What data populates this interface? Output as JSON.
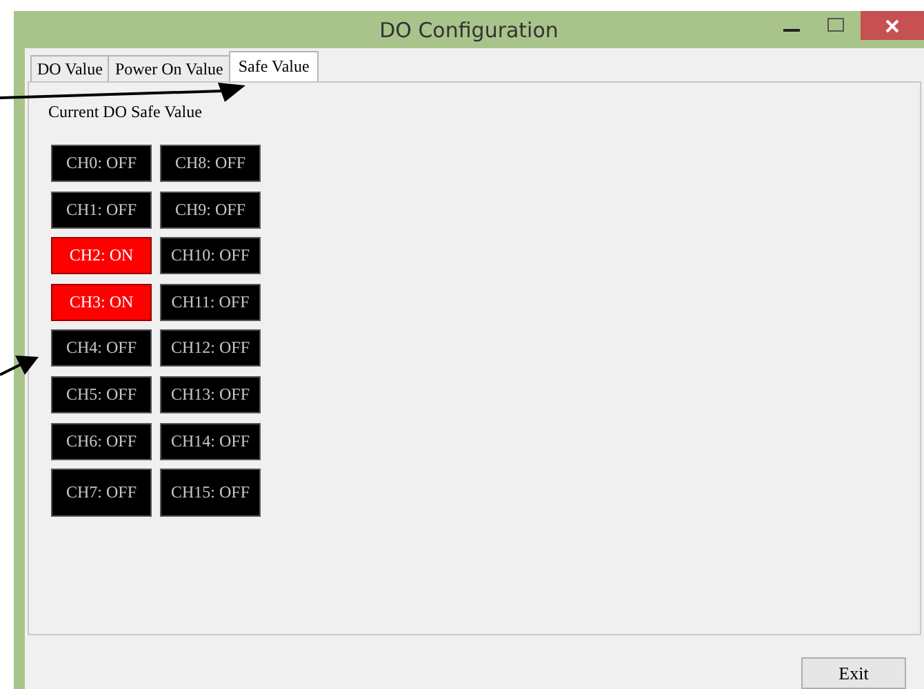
{
  "window": {
    "title": "DO Configuration"
  },
  "tabs": [
    {
      "label": "DO Value",
      "selected": false
    },
    {
      "label": "Power On Value",
      "selected": false
    },
    {
      "label": "Safe Value",
      "selected": true
    }
  ],
  "group_label": "Current DO Safe Value",
  "channels": [
    {
      "label": "CH0: OFF",
      "on": false
    },
    {
      "label": "CH1: OFF",
      "on": false
    },
    {
      "label": "CH2: ON",
      "on": true
    },
    {
      "label": "CH3: ON",
      "on": true
    },
    {
      "label": "CH4: OFF",
      "on": false
    },
    {
      "label": "CH5: OFF",
      "on": false
    },
    {
      "label": "CH6: OFF",
      "on": false
    },
    {
      "label": "CH7: OFF",
      "on": false
    },
    {
      "label": "CH8: OFF",
      "on": false
    },
    {
      "label": "CH9: OFF",
      "on": false
    },
    {
      "label": "CH10: OFF",
      "on": false
    },
    {
      "label": "CH11: OFF",
      "on": false
    },
    {
      "label": "CH12: OFF",
      "on": false
    },
    {
      "label": "CH13: OFF",
      "on": false
    },
    {
      "label": "CH14: OFF",
      "on": false
    },
    {
      "label": "CH15: OFF",
      "on": false
    }
  ],
  "buttons": [
    "Exit"
  ]
}
